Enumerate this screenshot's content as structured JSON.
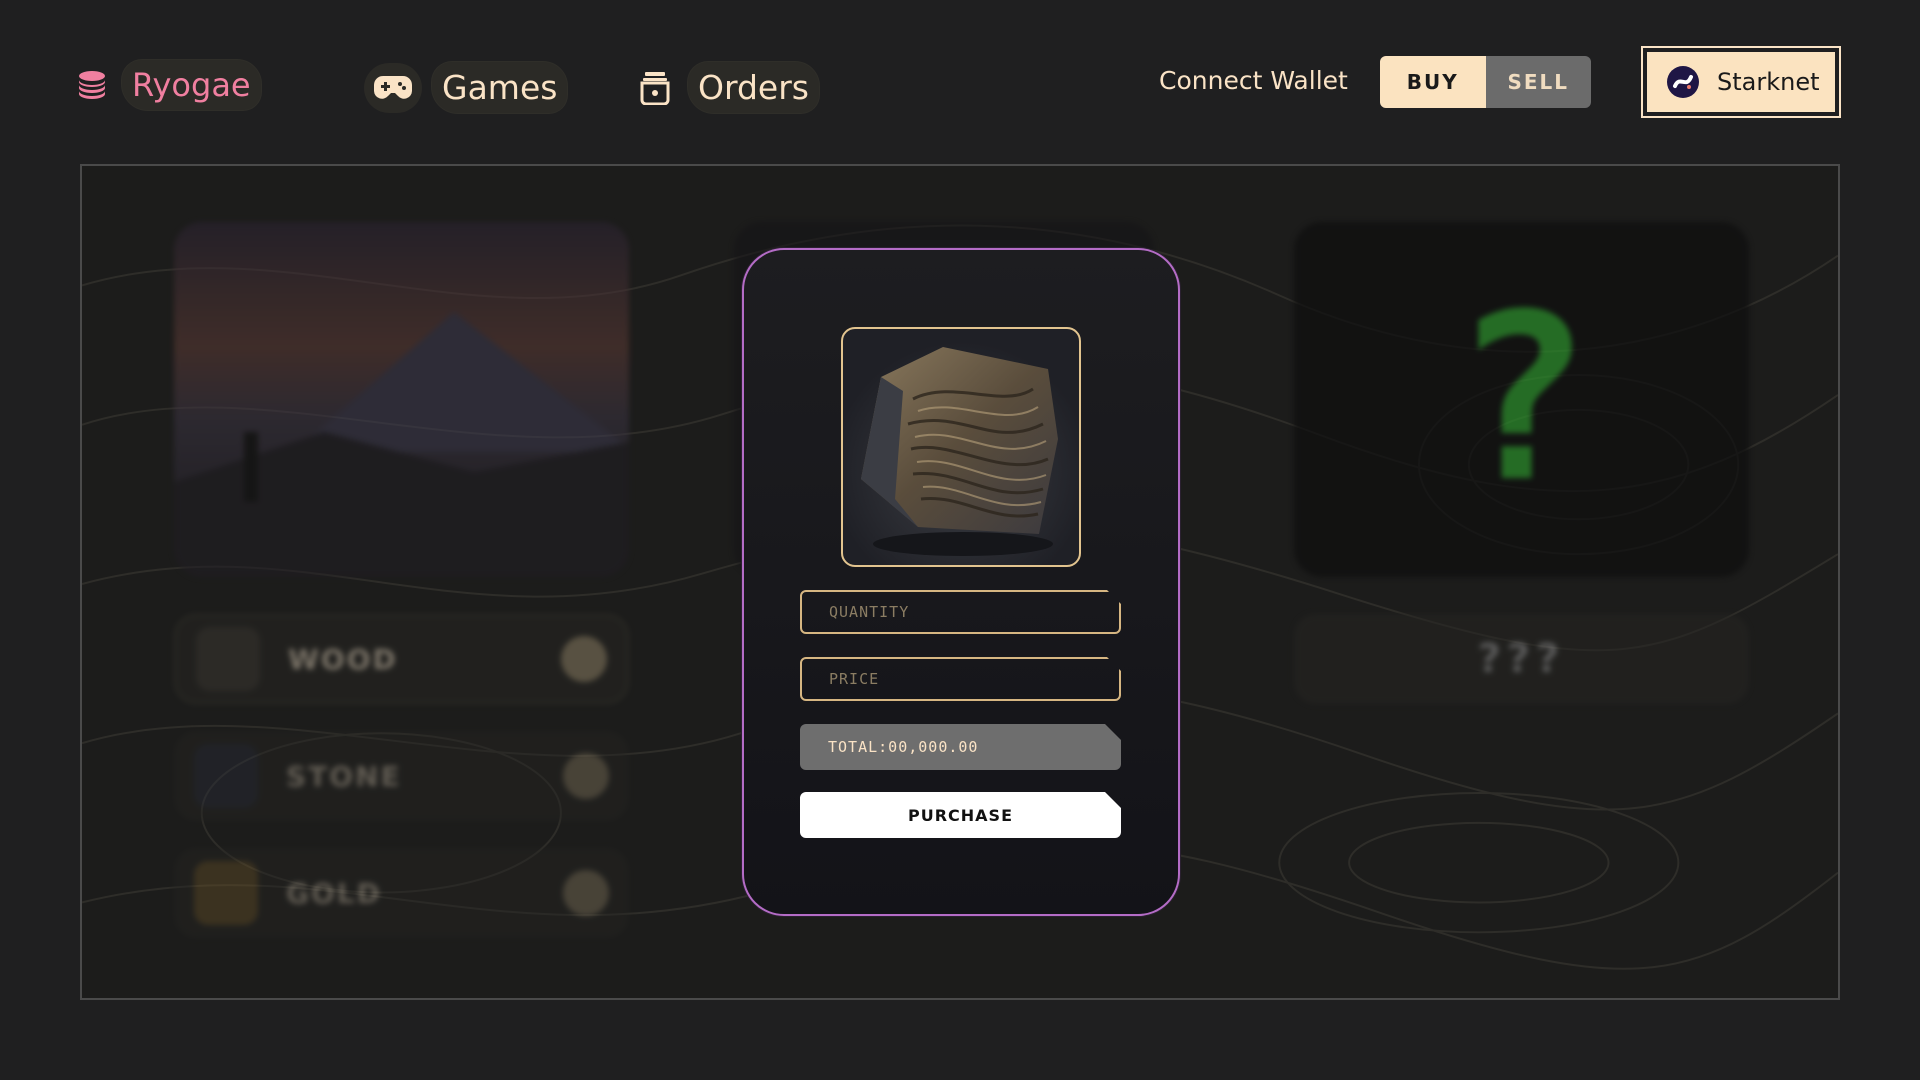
{
  "header": {
    "brand": "Ryogae",
    "nav": {
      "games": "Games",
      "orders": "Orders"
    },
    "connect_wallet": "Connect Wallet",
    "toggle": {
      "buy": "BUY",
      "sell": "SELL",
      "active": "BUY"
    },
    "network": "Starknet"
  },
  "background": {
    "resources": [
      {
        "name": "WOOD"
      },
      {
        "name": "STONE"
      },
      {
        "name": "GOLD"
      }
    ],
    "mystery_glyph": "?",
    "mystery_label": "???"
  },
  "modal": {
    "quantity_placeholder": "QUANTITY",
    "price_placeholder": "PRICE",
    "total": "TOTAL:00,000.00",
    "purchase": "PURCHASE"
  },
  "colors": {
    "brand": "#f07fa0",
    "cream": "#fae3c6",
    "modal_border": "#b46cc6",
    "field_border": "#d6b682",
    "mystery_green": "#2a8f2a"
  },
  "icons": [
    "coins-icon",
    "gamepad-icon",
    "jar-icon",
    "starknet-logo-icon",
    "plus-icon"
  ]
}
